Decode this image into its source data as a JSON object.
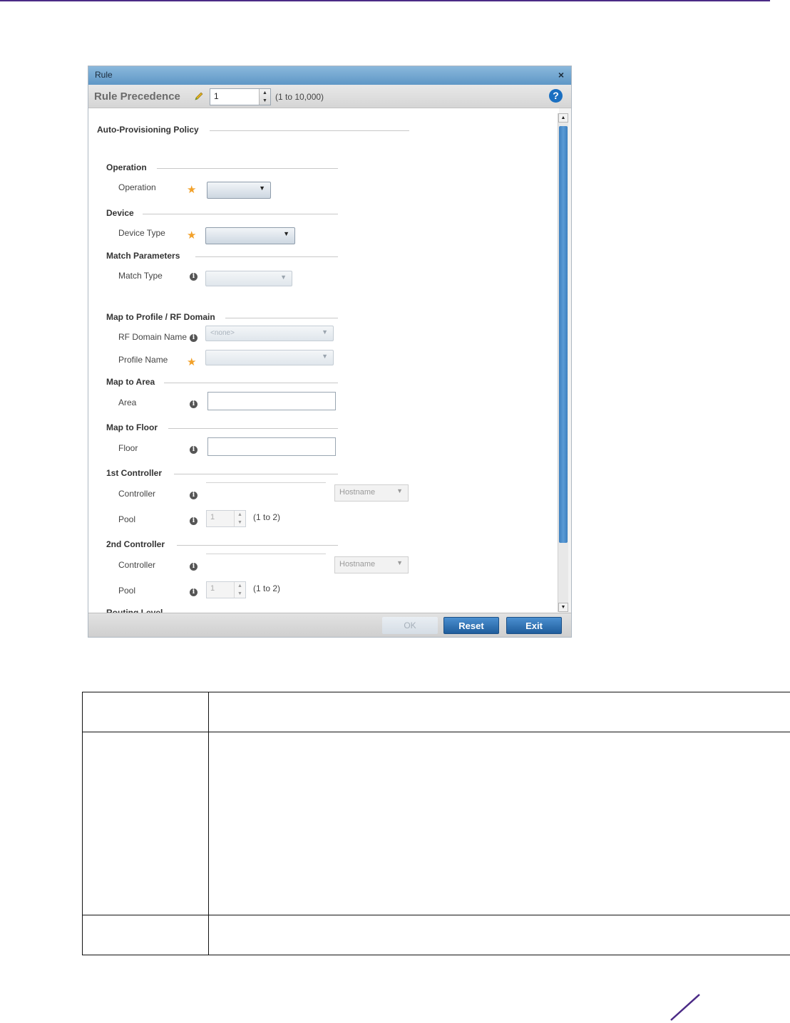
{
  "dialog": {
    "title": "Rule",
    "close_glyph": "×",
    "precedence": {
      "label": "Rule Precedence",
      "value": "1",
      "range": "(1 to 10,000)"
    },
    "help_glyph": "?",
    "section_title": "Auto-Provisioning Policy",
    "groups": {
      "operation": {
        "title": "Operation",
        "label": "Operation"
      },
      "device": {
        "title": "Device",
        "label": "Device Type"
      },
      "match": {
        "title": "Match Parameters",
        "label": "Match Type"
      },
      "map_profile": {
        "title": "Map to Profile / RF Domain",
        "rf_label": "RF Domain Name",
        "rf_value": "<none>",
        "profile_label": "Profile Name"
      },
      "map_area": {
        "title": "Map to Area",
        "label": "Area"
      },
      "map_floor": {
        "title": "Map to Floor",
        "label": "Floor"
      },
      "controller1": {
        "title": "1st Controller",
        "controller_label": "Controller",
        "type_value": "Hostname",
        "pool_label": "Pool",
        "pool_value": "1",
        "pool_range": "(1 to 2)"
      },
      "controller2": {
        "title": "2nd Controller",
        "controller_label": "Controller",
        "type_value": "Hostname",
        "pool_label": "Pool",
        "pool_value": "1",
        "pool_range": "(1 to 2)"
      },
      "routing": {
        "title": "Routing Level"
      }
    },
    "footer": {
      "ok_label": "OK",
      "reset_label": "Reset",
      "exit_label": "Exit"
    }
  },
  "icons": {
    "info": "i",
    "star": "★",
    "caret_down": "▼",
    "caret_up": "▲"
  },
  "colors": {
    "accent_blue": "#1f5d9c",
    "title_bar": "#5f97c6",
    "required_star": "#f2a12a",
    "brand_line": "#4b2a86"
  }
}
